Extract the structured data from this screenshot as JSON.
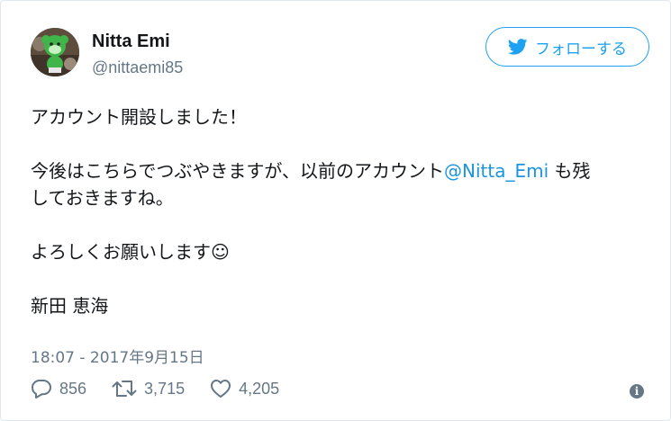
{
  "user": {
    "name": "Nitta Emi",
    "handle": "@nittaemi85"
  },
  "follow_button": {
    "label": "フォローする",
    "icon": "twitter-bird-icon",
    "color": "#1da1f2"
  },
  "tweet": {
    "line1": "アカウント開設しました！",
    "line2_pre": "今後はこちらでつぶやきますが、以前のアカウント",
    "mention": "@Nitta_Emi",
    "line2_post": " も残",
    "line3": "しておきますね。",
    "line4": "よろしくお願いします☺",
    "signature": "新田 恵海"
  },
  "timestamp": "18:07 - 2017年9月15日",
  "stats": {
    "replies": "856",
    "retweets": "3,715",
    "likes": "4,205"
  },
  "colors": {
    "text": "#14171a",
    "secondary": "#657786",
    "link": "#1b95e0",
    "border": "#e1e8ed"
  }
}
